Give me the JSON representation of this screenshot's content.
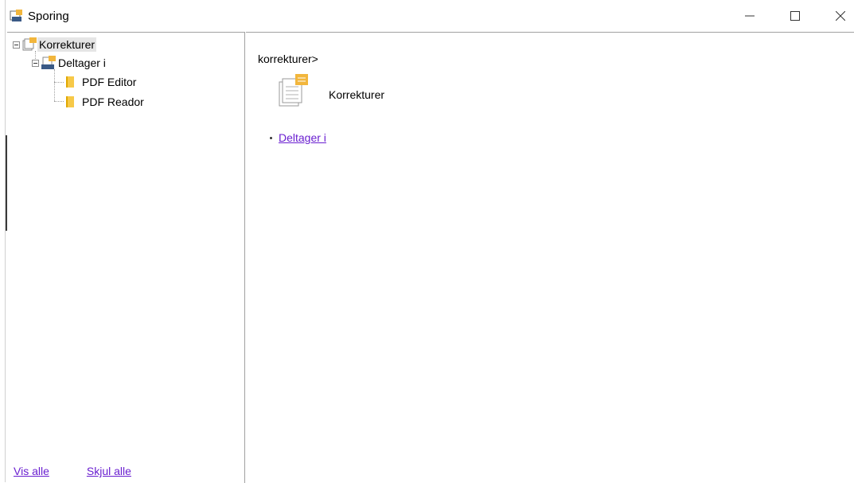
{
  "window": {
    "title": "Sporing"
  },
  "tree": {
    "root": {
      "label": "Korrekturer"
    },
    "child": {
      "label": "Deltager i"
    },
    "leaves": [
      {
        "label": "PDF Editor"
      },
      {
        "label": "PDF Reador"
      }
    ]
  },
  "footer": {
    "show_all": "Vis alle",
    "hide_all": "Skjul alle"
  },
  "content": {
    "breadcrumb": "korrekturer>",
    "item_label": "Korrekturer",
    "links": [
      {
        "label": "Deltager i"
      }
    ]
  },
  "colors": {
    "link": "#6a1fd0",
    "folder": "#f7c948",
    "note": "#f2b63c"
  }
}
